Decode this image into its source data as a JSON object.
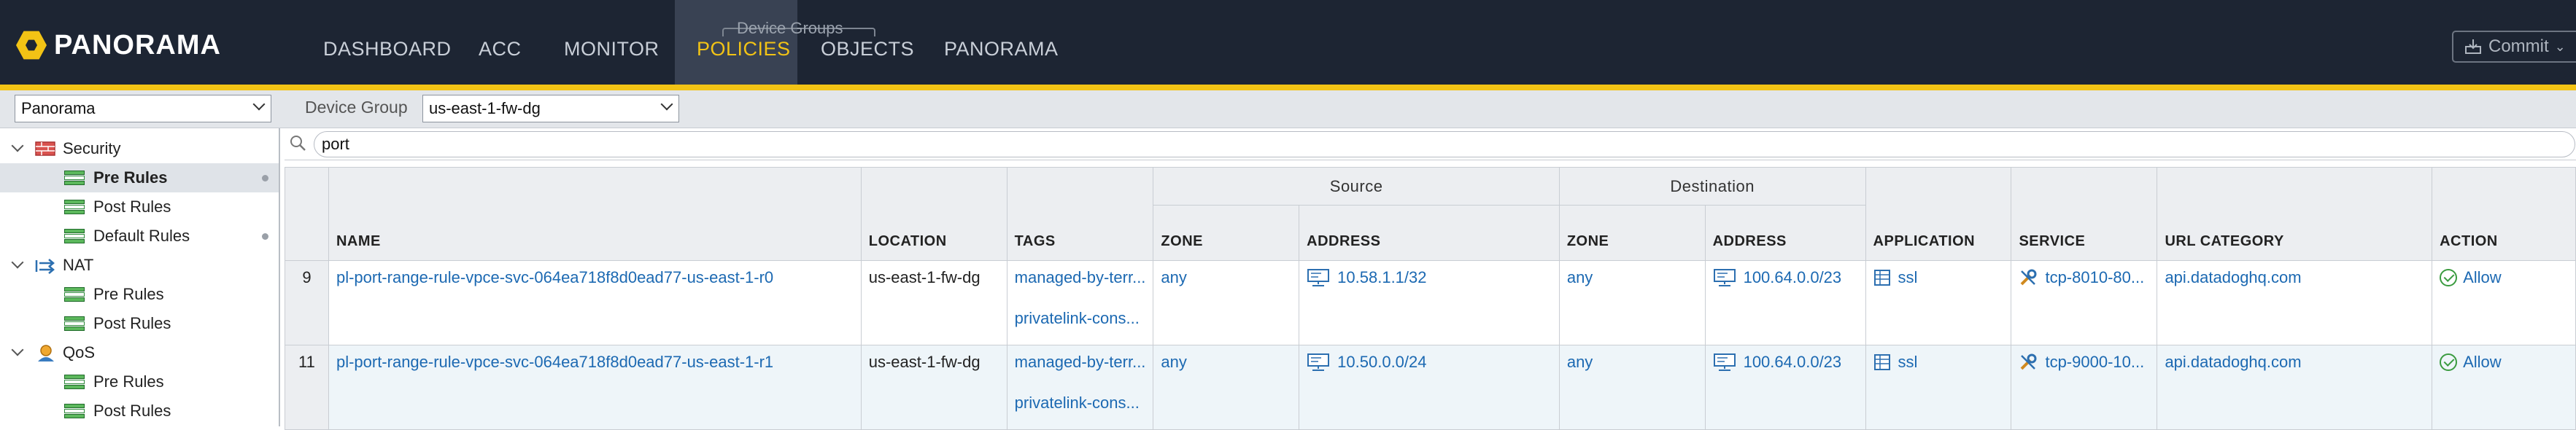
{
  "app": {
    "logo_text": "PANORAMA"
  },
  "nav": {
    "tabs": [
      "DASHBOARD",
      "ACC",
      "MONITOR",
      "POLICIES",
      "OBJECTS",
      "PANORAMA"
    ],
    "active_tab": "POLICIES",
    "device_groups_label": "Device Groups",
    "commit_label": "Commit"
  },
  "filter": {
    "context_select": "Panorama",
    "device_group_label": "Device Group",
    "device_group_value": "us-east-1-fw-dg"
  },
  "tree": {
    "security": "Security",
    "security_pre": "Pre Rules",
    "security_post": "Post Rules",
    "security_default": "Default Rules",
    "nat": "NAT",
    "nat_pre": "Pre Rules",
    "nat_post": "Post Rules",
    "qos": "QoS",
    "qos_pre": "Pre Rules",
    "qos_post": "Post Rules"
  },
  "search": {
    "query": "port"
  },
  "table": {
    "group_source": "Source",
    "group_destination": "Destination",
    "headers": {
      "name": "NAME",
      "location": "LOCATION",
      "tags": "TAGS",
      "src_zone": "ZONE",
      "src_address": "ADDRESS",
      "dst_zone": "ZONE",
      "dst_address": "ADDRESS",
      "application": "APPLICATION",
      "service": "SERVICE",
      "url_category": "URL CATEGORY",
      "action": "ACTION"
    },
    "rows": [
      {
        "num": "9",
        "name": "pl-port-range-rule-vpce-svc-064ea718f8d0ead77-us-east-1-r0",
        "location": "us-east-1-fw-dg",
        "tag1": "managed-by-terr...",
        "tag2": "privatelink-cons...",
        "src_zone": "any",
        "src_address": "10.58.1.1/32",
        "dst_zone": "any",
        "dst_address": "100.64.0.0/23",
        "application": "ssl",
        "service": "tcp-8010-80...",
        "url_category": "api.datadoghq.com",
        "action": "Allow"
      },
      {
        "num": "11",
        "name": "pl-port-range-rule-vpce-svc-064ea718f8d0ead77-us-east-1-r1",
        "location": "us-east-1-fw-dg",
        "tag1": "managed-by-terr...",
        "tag2": "privatelink-cons...",
        "src_zone": "any",
        "src_address": "10.50.0.0/24",
        "dst_zone": "any",
        "dst_address": "100.64.0.0/23",
        "application": "ssl",
        "service": "tcp-9000-10...",
        "url_category": "api.datadoghq.com",
        "action": "Allow"
      }
    ]
  }
}
